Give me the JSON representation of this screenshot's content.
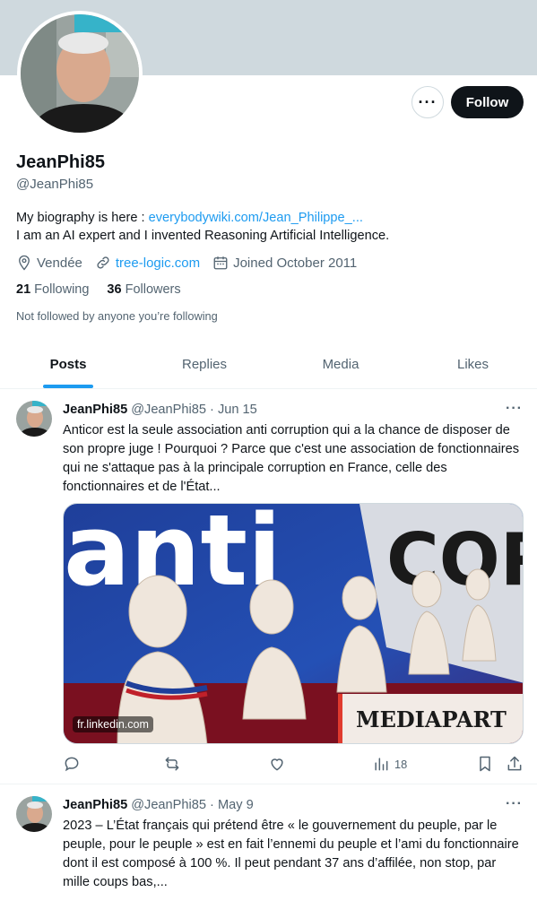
{
  "profile": {
    "display_name": "JeanPhi85",
    "handle": "@JeanPhi85",
    "bio_prefix": "My biography is here : ",
    "bio_link": "everybodywiki.com/Jean_Philippe_...",
    "bio_line2": "I am an AI expert and I invented Reasoning Artificial Intelligence.",
    "location": "Vendée",
    "website": "tree-logic.com",
    "joined": "Joined October 2011",
    "following_count": "21",
    "following_label": "Following",
    "followers_count": "36",
    "followers_label": "Followers",
    "not_followed": "Not followed by anyone you’re following"
  },
  "buttons": {
    "more": "···",
    "follow": "Follow"
  },
  "tabs": [
    {
      "label": "Posts"
    },
    {
      "label": "Replies"
    },
    {
      "label": "Media"
    },
    {
      "label": "Likes"
    }
  ],
  "posts": [
    {
      "name": "JeanPhi85",
      "handle_date": "@JeanPhi85 · Jun 15",
      "more": "···",
      "text": "Anticor est la seule association anti corruption qui a la chance de disposer de son propre juge ! Pourquoi ? Parce que c'est une association de fonctionnaires qui ne s'attaque pas à la principale corruption en France, celle des fonctionnaires et de l'État...",
      "media_domain": "fr.linkedin.com",
      "media_word1": "anti",
      "media_word2": "COR",
      "media_brand": "MEDIAPART",
      "views": "18"
    },
    {
      "name": "JeanPhi85",
      "handle_date": "@JeanPhi85 · May 9",
      "more": "···",
      "text": "2023 – L’État français qui prétend être « le gouvernement du peuple, par le peuple, pour le peuple » est en fait l’ennemi du peuple et l’ami  du fonctionnaire dont il est composé à 100 %. Il peut pendant 37 ans d’affilée, non stop, par mille coups bas,..."
    }
  ],
  "colors": {
    "accent": "#1d9bf0",
    "banner": "#cfd9de",
    "text": "#0f1419",
    "muted": "#536471"
  }
}
